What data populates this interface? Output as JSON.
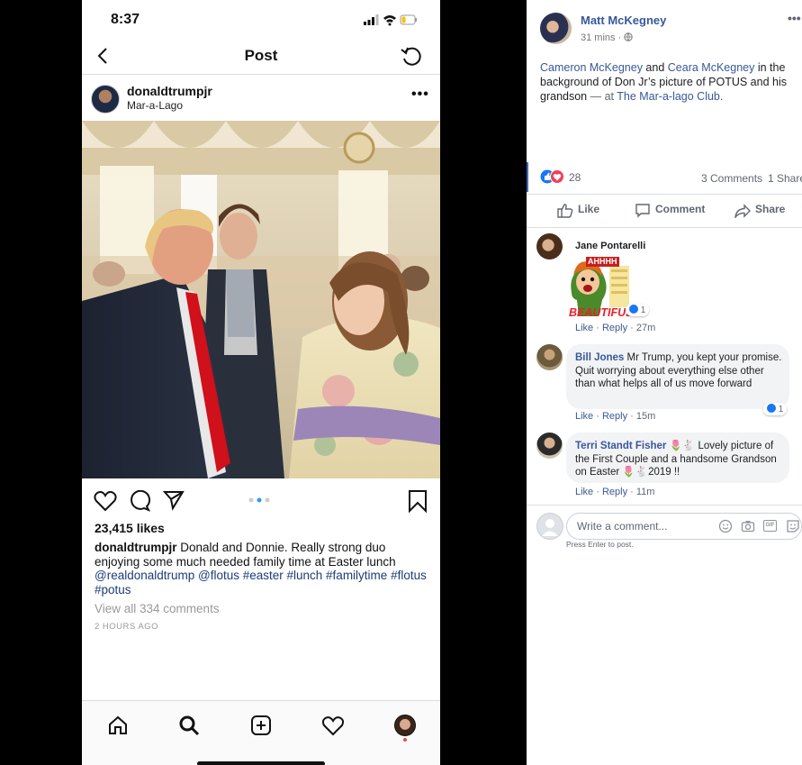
{
  "instagram": {
    "status_time": "8:37",
    "nav_title": "Post",
    "username": "donaldtrumpjr",
    "location": "Mar-a-Lago",
    "likes": "23,415 likes",
    "caption_user": "donaldtrumpjr",
    "caption_text": " Donald and Donnie. Really strong duo enjoying some much needed family time at Easter lunch",
    "caption_tags": "@realdonaldtrump @flotus #easter #lunch #familytime #flotus #potus",
    "view_all": "View all 334 comments",
    "posted_ago": "2 HOURS AGO",
    "icons": {
      "back": "chevron-left-icon",
      "refresh": "refresh-icon",
      "more": "more-dots-icon",
      "like": "heart-icon",
      "comment": "comment-bubble-icon",
      "share": "send-icon",
      "save": "bookmark-icon",
      "tabs": [
        "home-icon",
        "search-icon",
        "add-post-icon",
        "activity-heart-icon",
        "profile-avatar"
      ]
    }
  },
  "facebook": {
    "author": "Matt McKegney",
    "time": "31 mins · ",
    "post": {
      "name1": "Cameron McKegney",
      "and": " and ",
      "name2": "Ceara McKegney",
      "text": " in the background of Don Jr’s picture of POTUS and his grandson",
      "at": " — at ",
      "place": "The Mar-a-lago Club",
      "end": "."
    },
    "reactions_count": "28",
    "comments_count": "3 Comments",
    "shares_count": "1 Share",
    "actions": {
      "like": "Like",
      "comment": "Comment",
      "share": "Share"
    },
    "comments": [
      {
        "name": "Jane Pontarelli",
        "text": "",
        "sticker_top": "AHHHH",
        "sticker_bottom": "BEAUTIFUL.",
        "reactions": "1",
        "like": "Like",
        "reply": "Reply",
        "time": "27m"
      },
      {
        "name": "Bill Jones",
        "text": " Mr Trump, you kept your promise. Quit worrying about everything else other than what helps all of us move forward",
        "reactions": "1",
        "like": "Like",
        "reply": "Reply",
        "time": "15m"
      },
      {
        "name": "Terri Standt Fisher",
        "text1": "Lovely picture of the First Couple and a handsome Grandson on Easter ",
        "text2": "2019 !!",
        "like": "Like",
        "reply": "Reply",
        "time": "11m"
      }
    ],
    "write_placeholder": "Write a comment...",
    "press_enter": "Press Enter to post.",
    "gif_label": "GIF",
    "colors": {
      "link": "#385898",
      "like_blue": "#1877f2",
      "love_red": "#f33e58"
    }
  }
}
